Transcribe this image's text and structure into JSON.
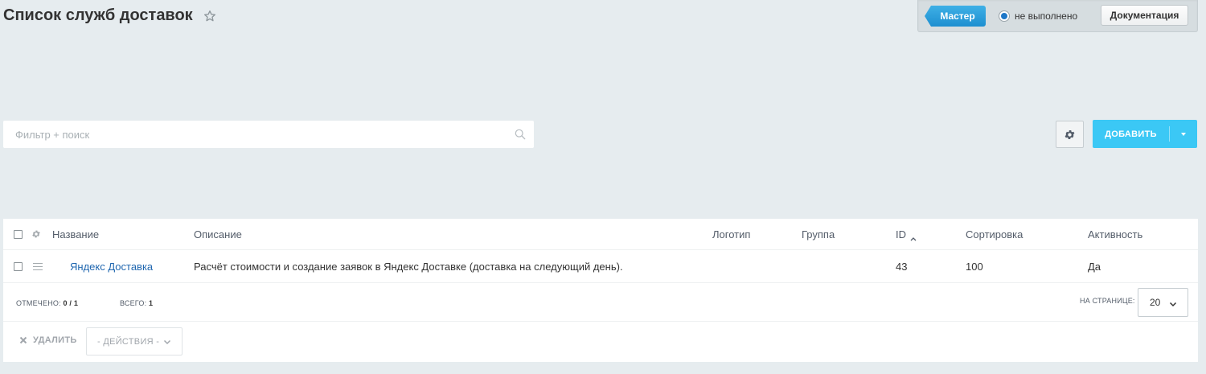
{
  "header": {
    "title": "Список служб доставок"
  },
  "top_panel": {
    "master_label": "Мастер",
    "status_label": "не выполнено",
    "docs_label": "Документация"
  },
  "filter": {
    "placeholder": "Фильтр + поиск"
  },
  "toolbar": {
    "add_label": "ДОБАВИТЬ"
  },
  "grid": {
    "columns": {
      "name": "Название",
      "description": "Описание",
      "logo": "Логотип",
      "group": "Группа",
      "id": "ID",
      "sort": "Сортировка",
      "active": "Активность"
    },
    "rows": [
      {
        "name": "Яндекс Доставка",
        "description": "Расчёт стоимости и создание заявок в Яндекс Доставке (доставка на следующий день).",
        "logo": "",
        "group": "",
        "id": "43",
        "sort": "100",
        "active": "Да"
      }
    ]
  },
  "footer": {
    "selected_label": "ОТМЕЧЕНО:",
    "selected_value": "0 / 1",
    "total_label": "ВСЕГО:",
    "total_value": "1",
    "per_page_label": "НА СТРАНИЦЕ:",
    "per_page_value": "20",
    "delete_label": "УДАЛИТЬ",
    "actions_label": "- ДЕЙСТВИЯ -"
  },
  "colors": {
    "background": "#e6ecef",
    "accent": "#3bc8f5",
    "link": "#2067b0"
  }
}
